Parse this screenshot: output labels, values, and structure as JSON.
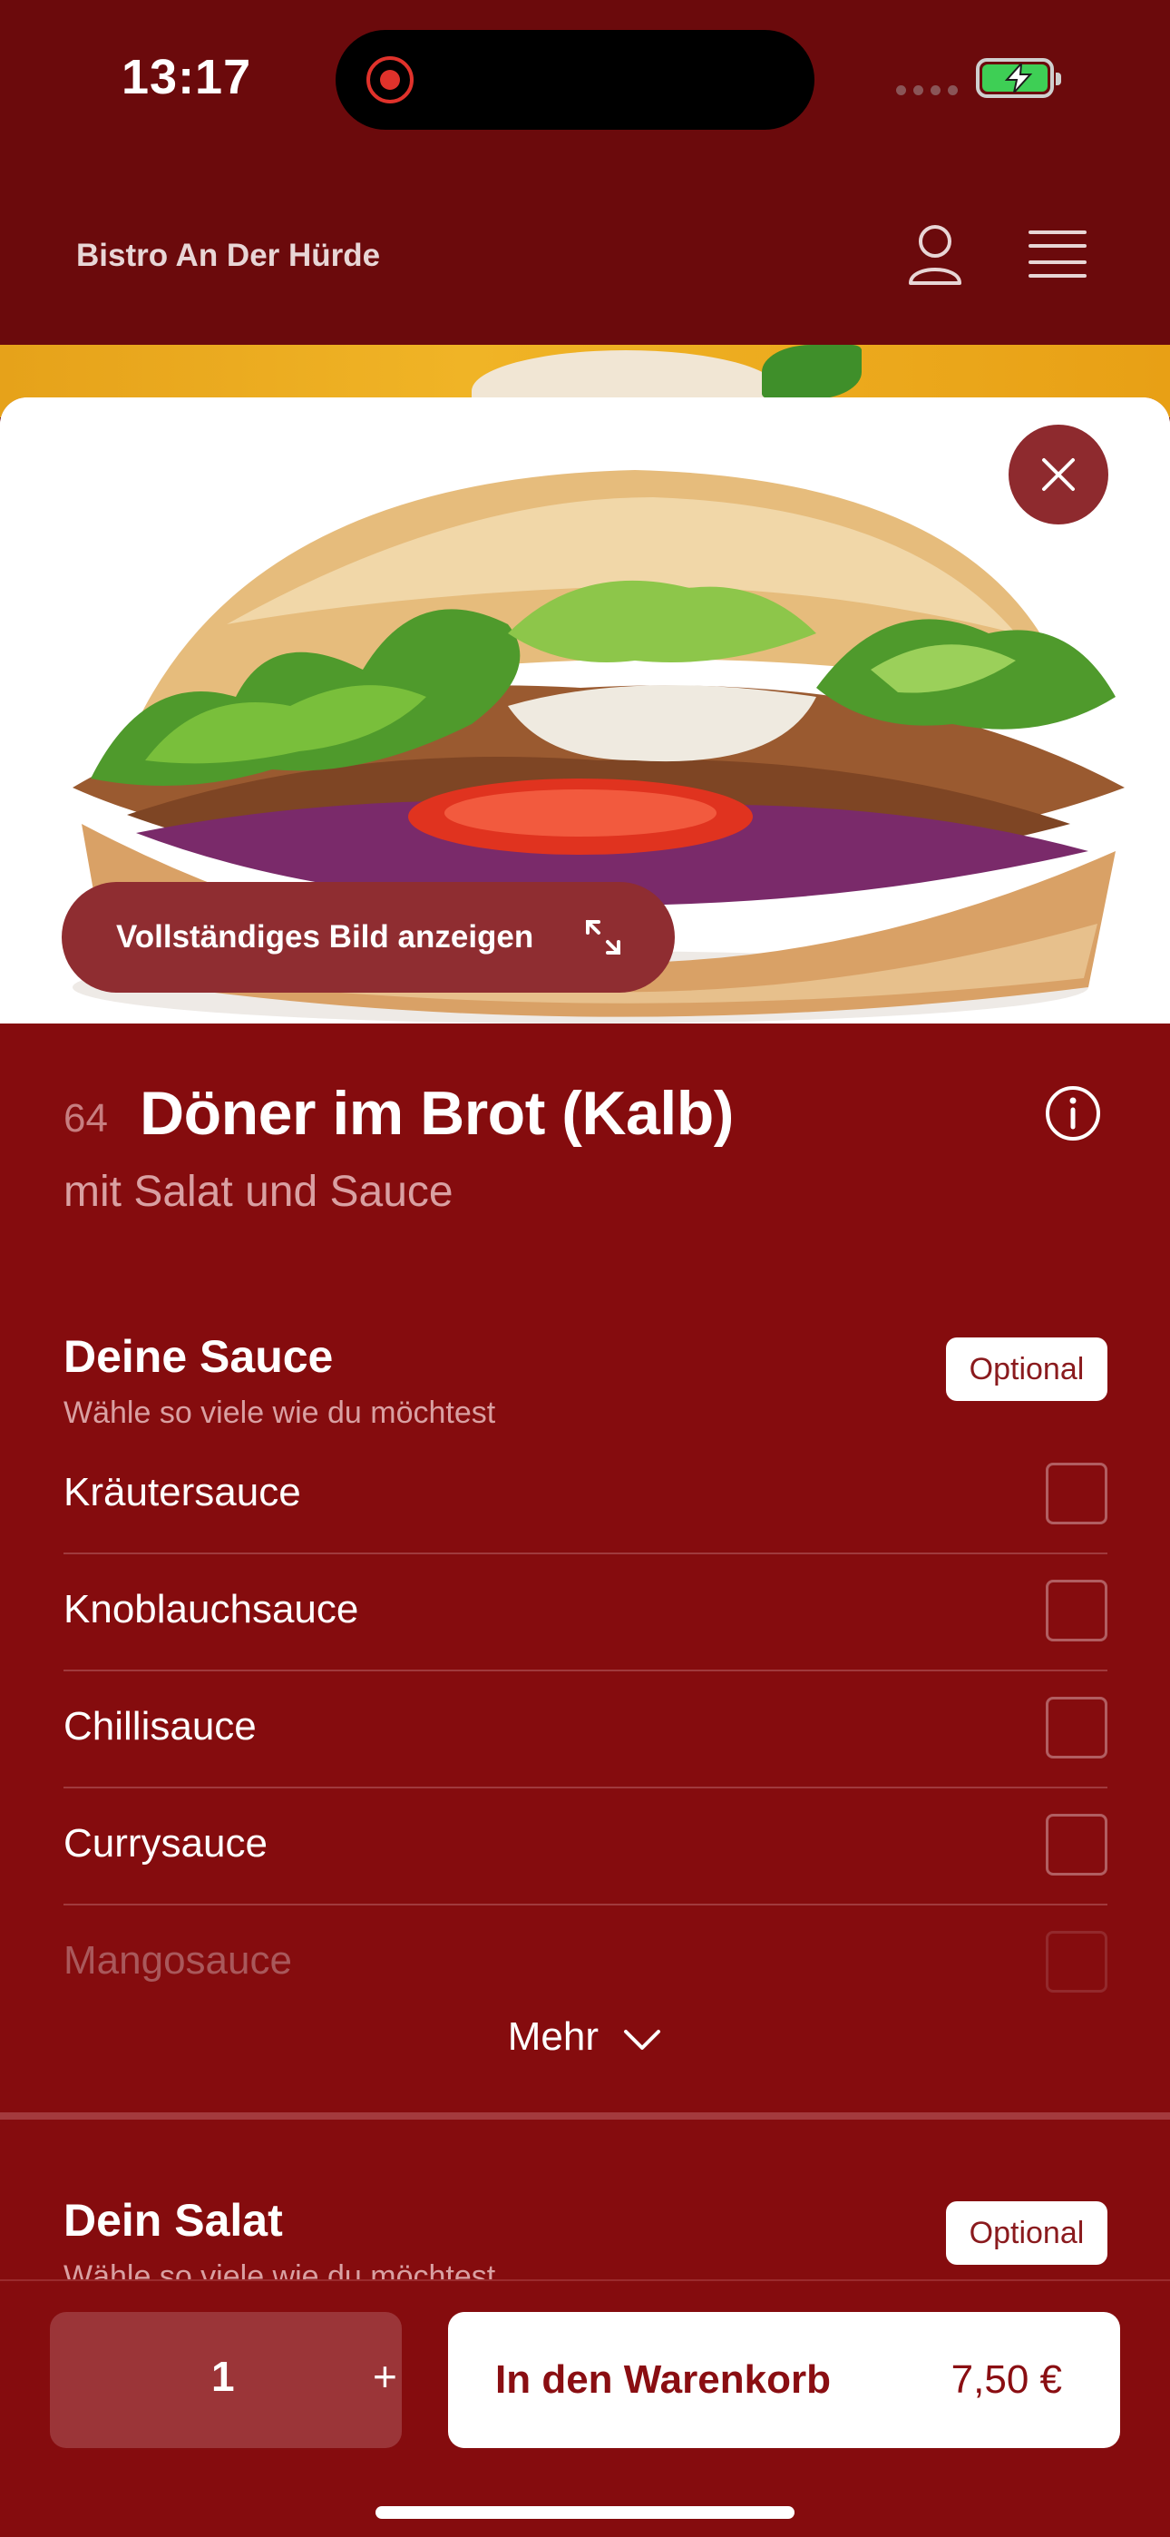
{
  "status_bar": {
    "time": "13:17"
  },
  "header": {
    "title": "Bistro An Der Hürde"
  },
  "product_sheet": {
    "full_image_label": "Vollständiges Bild anzeigen",
    "number": "64",
    "title": "Döner im Brot (Kalb)",
    "subtitle": "mit Salat und Sauce"
  },
  "sauce_section": {
    "title": "Deine Sauce",
    "hint": "Wähle so viele wie du möchtest",
    "badge": "Optional",
    "options": [
      {
        "label": "Kräutersauce",
        "checked": false
      },
      {
        "label": "Knoblauchsauce",
        "checked": false
      },
      {
        "label": "Chillisauce",
        "checked": false
      },
      {
        "label": "Currysauce",
        "checked": false
      },
      {
        "label": "Mangosauce",
        "checked": false
      }
    ],
    "more_label": "Mehr"
  },
  "salad_section": {
    "title": "Dein Salat",
    "hint": "Wähle so viele wie du möchtest",
    "badge": "Optional"
  },
  "bottom_bar": {
    "quantity": "1",
    "plus_label": "+",
    "cart_label": "In den Warenkorb",
    "price": "7,50 €"
  },
  "colors": {
    "brand": "#850c0e",
    "header": "#6b0a0c",
    "accent_button": "#8e2a2e"
  },
  "icons": [
    "profile-icon",
    "menu-icon",
    "close-icon",
    "expand-icon",
    "info-icon",
    "chevron-down-icon"
  ]
}
